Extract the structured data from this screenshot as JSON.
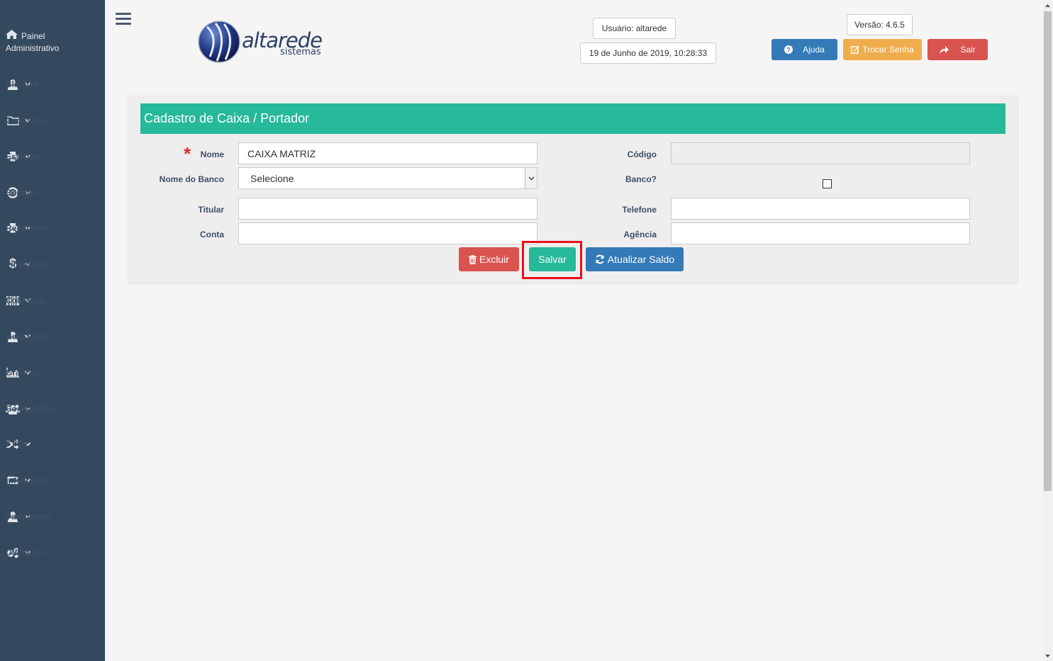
{
  "sidebar": {
    "top_label_line1": "Painel",
    "top_label_line2": "Administrativo",
    "items": [
      {
        "label": "Clientes",
        "icon": "user-icon"
      },
      {
        "label": "Cadastros",
        "icon": "folder-icon"
      },
      {
        "label": "Estoque",
        "icon": "printer-icon"
      },
      {
        "label": "Suporte",
        "icon": "lifebuoy-icon"
      },
      {
        "label": "Relatórios",
        "icon": "printer-icon"
      },
      {
        "label": "Financeiro",
        "icon": "dollar-icon"
      },
      {
        "label": "Cobrança",
        "icon": "barcode-icon"
      },
      {
        "label": "Nota Fiscal",
        "icon": "user-icon"
      },
      {
        "label": "Gráficos",
        "icon": "area-chart-icon"
      },
      {
        "label": "Conectados",
        "icon": "users-icon"
      },
      {
        "label": "FTTH",
        "icon": "shuffle-icon"
      },
      {
        "label": "Integraçao",
        "icon": "retweet-icon"
      },
      {
        "label": "Parâmetros",
        "icon": "user-icon"
      },
      {
        "label": "Utilitários",
        "icon": "cogs-icon"
      }
    ]
  },
  "header": {
    "logo_text": "altarede",
    "logo_sub": "sistemas",
    "user": "Usuário: altarede",
    "datetime": "19 de Junho de 2019, 10:28:33",
    "version": "Versão: 4.6.5",
    "help_label": "Ajuda",
    "change_password_label": "Trocar Senha",
    "logout_label": "Sair"
  },
  "form": {
    "title": "Cadastro de Caixa / Portador",
    "nome_label": "Nome",
    "nome_value": "CAIXA MATRIZ",
    "codigo_label": "Código",
    "codigo_value": "",
    "banco_nome_label": "Nome do Banco",
    "banco_nome_value": "Selecione",
    "banco_label": "Banco?",
    "banco_checked": false,
    "titular_label": "Titular",
    "titular_value": "",
    "telefone_label": "Telefone",
    "telefone_value": "",
    "conta_label": "Conta",
    "conta_value": "",
    "agencia_label": "Agência",
    "agencia_value": "",
    "delete_label": "Excluir",
    "save_label": "Salvar",
    "refresh_label": "Atualizar Saldo"
  },
  "colors": {
    "sidebar_bg": "#34495e",
    "header_green": "#26b99a",
    "blue": "#337ab7",
    "orange": "#f0ad4e",
    "red": "#d9534f",
    "highlight": "#e8101c"
  }
}
